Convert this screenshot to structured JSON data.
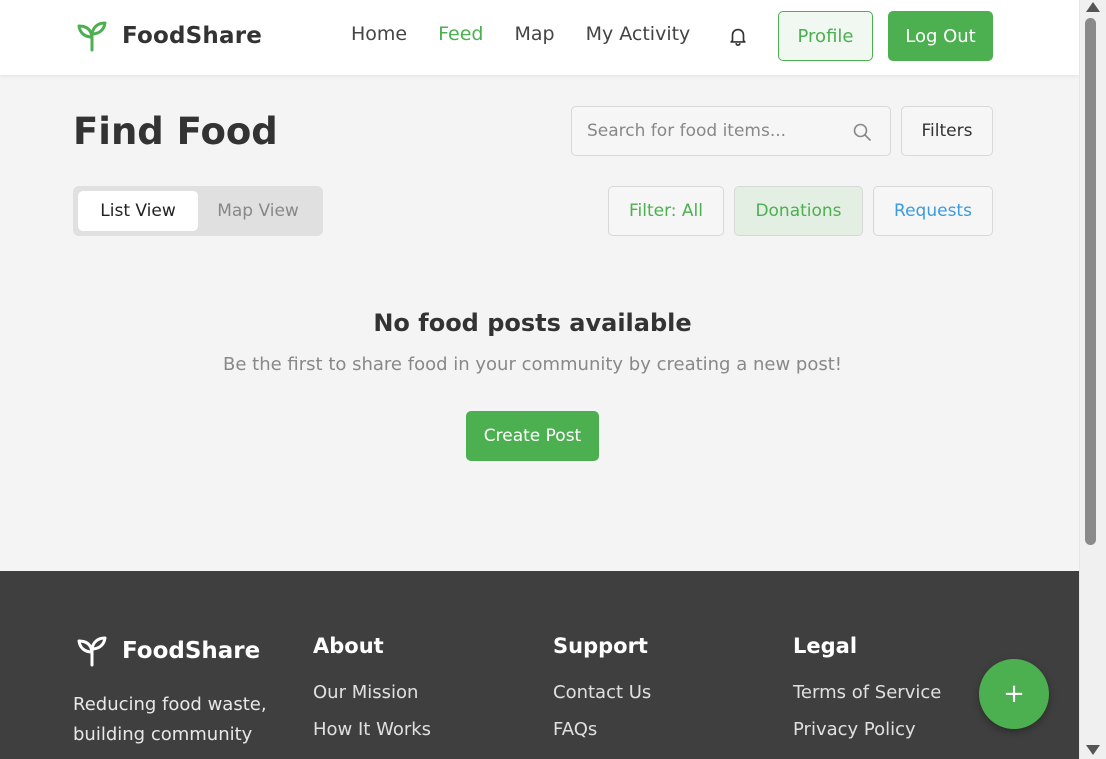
{
  "header": {
    "brand": "FoodShare",
    "nav": [
      {
        "label": "Home",
        "active": false
      },
      {
        "label": "Feed",
        "active": true
      },
      {
        "label": "Map",
        "active": false
      },
      {
        "label": "My Activity",
        "active": false
      }
    ],
    "profile_label": "Profile",
    "logout_label": "Log Out"
  },
  "main": {
    "title": "Find Food",
    "search_placeholder": "Search for food items...",
    "filters_label": "Filters",
    "view_toggle": {
      "list": "List View",
      "map": "Map View",
      "selected": "List View"
    },
    "chips": {
      "all": "Filter: All",
      "donations": "Donations",
      "requests": "Requests"
    },
    "empty": {
      "title": "No food posts available",
      "subtitle": "Be the first to share food in your community by creating a new post!",
      "button": "Create Post"
    }
  },
  "footer": {
    "brand": "FoodShare",
    "tagline": "Reducing food waste, building community",
    "columns": [
      {
        "title": "About",
        "links": [
          "Our Mission",
          "How It Works"
        ]
      },
      {
        "title": "Support",
        "links": [
          "Contact Us",
          "FAQs"
        ]
      },
      {
        "title": "Legal",
        "links": [
          "Terms of Service",
          "Privacy Policy"
        ]
      }
    ]
  },
  "fab_label": "+",
  "colors": {
    "brand": "#4caf50",
    "request": "#3c9be0",
    "footer_bg": "#3f3f3f"
  }
}
